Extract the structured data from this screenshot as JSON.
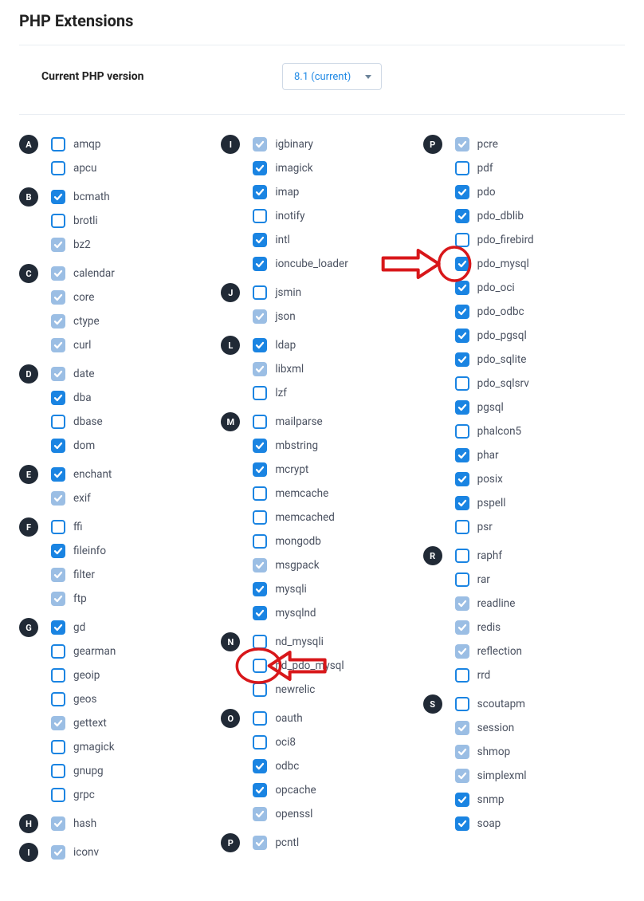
{
  "title": "PHP Extensions",
  "version": {
    "label": "Current PHP version",
    "selected": "8.1 (current)"
  },
  "columns": [
    {
      "groups": [
        {
          "letter": "A",
          "items": [
            {
              "name": "amqp",
              "state": "unchecked"
            },
            {
              "name": "apcu",
              "state": "unchecked"
            }
          ]
        },
        {
          "letter": "B",
          "items": [
            {
              "name": "bcmath",
              "state": "checked"
            },
            {
              "name": "brotli",
              "state": "unchecked"
            },
            {
              "name": "bz2",
              "state": "locked"
            }
          ]
        },
        {
          "letter": "C",
          "items": [
            {
              "name": "calendar",
              "state": "locked"
            },
            {
              "name": "core",
              "state": "locked"
            },
            {
              "name": "ctype",
              "state": "locked"
            },
            {
              "name": "curl",
              "state": "locked"
            }
          ]
        },
        {
          "letter": "D",
          "items": [
            {
              "name": "date",
              "state": "locked"
            },
            {
              "name": "dba",
              "state": "checked"
            },
            {
              "name": "dbase",
              "state": "unchecked"
            },
            {
              "name": "dom",
              "state": "checked"
            }
          ]
        },
        {
          "letter": "E",
          "items": [
            {
              "name": "enchant",
              "state": "checked"
            },
            {
              "name": "exif",
              "state": "locked"
            }
          ]
        },
        {
          "letter": "F",
          "items": [
            {
              "name": "ffi",
              "state": "unchecked"
            },
            {
              "name": "fileinfo",
              "state": "checked"
            },
            {
              "name": "filter",
              "state": "locked"
            },
            {
              "name": "ftp",
              "state": "locked"
            }
          ]
        },
        {
          "letter": "G",
          "items": [
            {
              "name": "gd",
              "state": "checked"
            },
            {
              "name": "gearman",
              "state": "unchecked"
            },
            {
              "name": "geoip",
              "state": "unchecked"
            },
            {
              "name": "geos",
              "state": "unchecked"
            },
            {
              "name": "gettext",
              "state": "locked"
            },
            {
              "name": "gmagick",
              "state": "unchecked"
            },
            {
              "name": "gnupg",
              "state": "unchecked"
            },
            {
              "name": "grpc",
              "state": "unchecked"
            }
          ]
        },
        {
          "letter": "H",
          "items": [
            {
              "name": "hash",
              "state": "locked"
            }
          ]
        },
        {
          "letter": "I",
          "items": [
            {
              "name": "iconv",
              "state": "locked"
            }
          ]
        }
      ]
    },
    {
      "groups": [
        {
          "letter": "I",
          "items": [
            {
              "name": "igbinary",
              "state": "locked"
            },
            {
              "name": "imagick",
              "state": "checked"
            },
            {
              "name": "imap",
              "state": "checked"
            },
            {
              "name": "inotify",
              "state": "unchecked"
            },
            {
              "name": "intl",
              "state": "checked"
            },
            {
              "name": "ioncube_loader",
              "state": "checked"
            }
          ]
        },
        {
          "letter": "J",
          "items": [
            {
              "name": "jsmin",
              "state": "unchecked"
            },
            {
              "name": "json",
              "state": "locked"
            }
          ]
        },
        {
          "letter": "L",
          "items": [
            {
              "name": "ldap",
              "state": "checked"
            },
            {
              "name": "libxml",
              "state": "locked"
            },
            {
              "name": "lzf",
              "state": "unchecked"
            }
          ]
        },
        {
          "letter": "M",
          "items": [
            {
              "name": "mailparse",
              "state": "unchecked"
            },
            {
              "name": "mbstring",
              "state": "checked"
            },
            {
              "name": "mcrypt",
              "state": "checked"
            },
            {
              "name": "memcache",
              "state": "unchecked"
            },
            {
              "name": "memcached",
              "state": "unchecked"
            },
            {
              "name": "mongodb",
              "state": "unchecked"
            },
            {
              "name": "msgpack",
              "state": "locked"
            },
            {
              "name": "mysqli",
              "state": "checked"
            },
            {
              "name": "mysqlnd",
              "state": "checked"
            }
          ]
        },
        {
          "letter": "N",
          "items": [
            {
              "name": "nd_mysqli",
              "state": "unchecked"
            },
            {
              "name": "nd_pdo_mysql",
              "state": "unchecked"
            },
            {
              "name": "newrelic",
              "state": "unchecked"
            }
          ]
        },
        {
          "letter": "O",
          "items": [
            {
              "name": "oauth",
              "state": "unchecked"
            },
            {
              "name": "oci8",
              "state": "unchecked"
            },
            {
              "name": "odbc",
              "state": "checked"
            },
            {
              "name": "opcache",
              "state": "checked"
            },
            {
              "name": "openssl",
              "state": "locked"
            }
          ]
        },
        {
          "letter": "P",
          "items": [
            {
              "name": "pcntl",
              "state": "locked"
            }
          ]
        }
      ]
    },
    {
      "groups": [
        {
          "letter": "P",
          "items": [
            {
              "name": "pcre",
              "state": "locked"
            },
            {
              "name": "pdf",
              "state": "unchecked"
            },
            {
              "name": "pdo",
              "state": "checked"
            },
            {
              "name": "pdo_dblib",
              "state": "checked"
            },
            {
              "name": "pdo_firebird",
              "state": "unchecked"
            },
            {
              "name": "pdo_mysql",
              "state": "checked"
            },
            {
              "name": "pdo_oci",
              "state": "checked"
            },
            {
              "name": "pdo_odbc",
              "state": "checked"
            },
            {
              "name": "pdo_pgsql",
              "state": "checked"
            },
            {
              "name": "pdo_sqlite",
              "state": "checked"
            },
            {
              "name": "pdo_sqlsrv",
              "state": "unchecked"
            },
            {
              "name": "pgsql",
              "state": "checked"
            },
            {
              "name": "phalcon5",
              "state": "unchecked"
            },
            {
              "name": "phar",
              "state": "checked"
            },
            {
              "name": "posix",
              "state": "checked"
            },
            {
              "name": "pspell",
              "state": "checked"
            },
            {
              "name": "psr",
              "state": "unchecked"
            }
          ]
        },
        {
          "letter": "R",
          "items": [
            {
              "name": "raphf",
              "state": "unchecked"
            },
            {
              "name": "rar",
              "state": "unchecked"
            },
            {
              "name": "readline",
              "state": "locked"
            },
            {
              "name": "redis",
              "state": "locked"
            },
            {
              "name": "reflection",
              "state": "locked"
            },
            {
              "name": "rrd",
              "state": "unchecked"
            }
          ]
        },
        {
          "letter": "S",
          "items": [
            {
              "name": "scoutapm",
              "state": "unchecked"
            },
            {
              "name": "session",
              "state": "locked"
            },
            {
              "name": "shmop",
              "state": "locked"
            },
            {
              "name": "simplexml",
              "state": "locked"
            },
            {
              "name": "snmp",
              "state": "checked"
            },
            {
              "name": "soap",
              "state": "checked"
            }
          ]
        }
      ]
    }
  ],
  "annotations": {
    "highlight_targets": [
      "pdo_mysql",
      "nd_pdo_mysql"
    ]
  }
}
